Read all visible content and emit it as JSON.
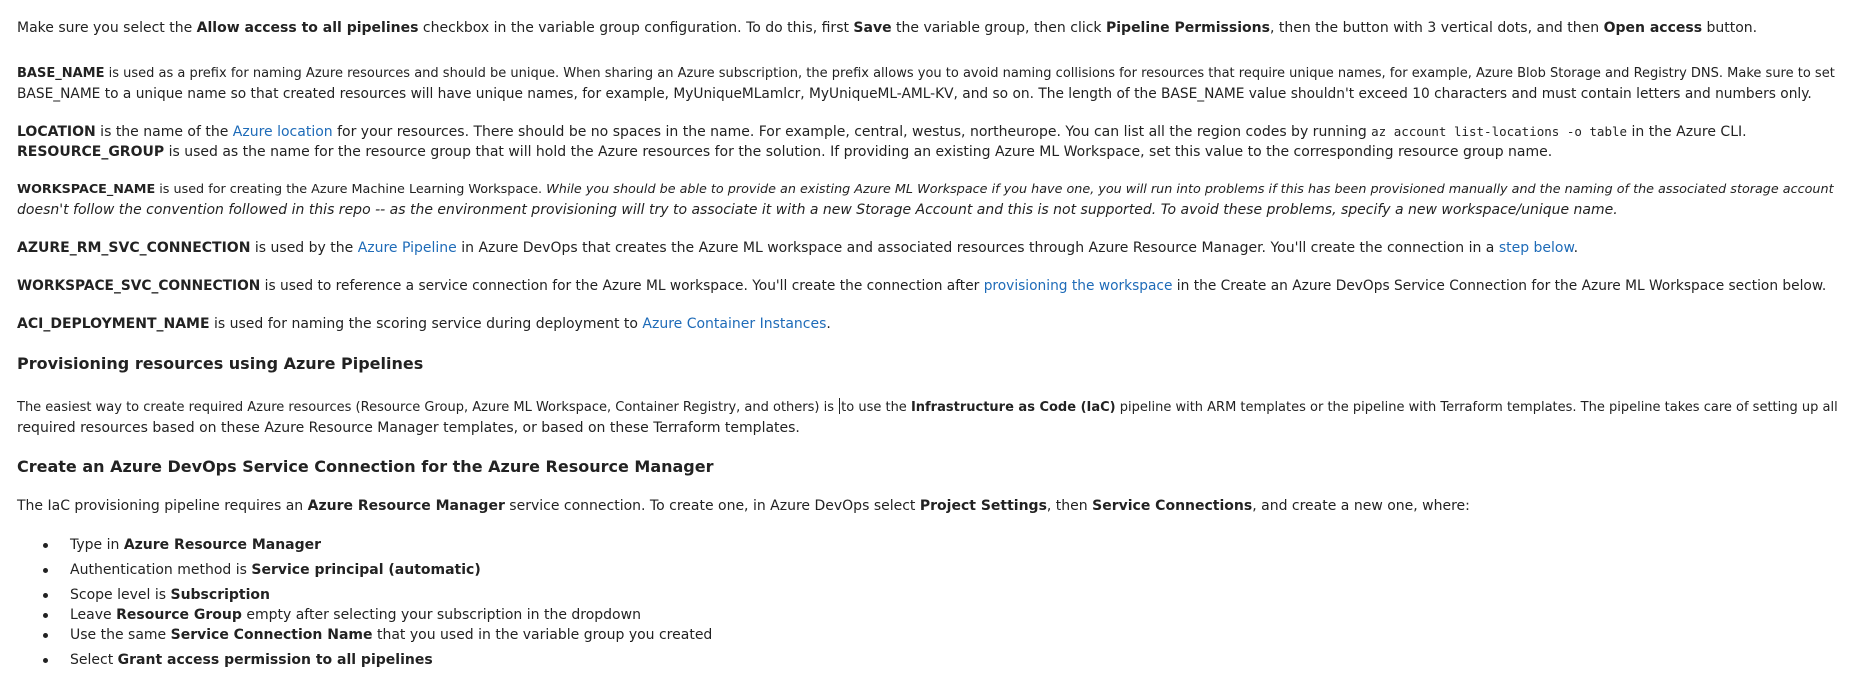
{
  "intro": {
    "t1": "Make sure you select the ",
    "b1": "Allow access to all pipelines",
    "t2": " checkbox in the variable group configuration. To do this, first ",
    "b2": "Save",
    "t3": " the variable group, then click ",
    "b3": "Pipeline Permissions",
    "t4": ", then the button with 3 vertical dots, and then ",
    "b4": "Open access",
    "t5": " button."
  },
  "base_name": {
    "term": "BASE_NAME",
    "l1": " is used as a prefix for naming Azure resources and should be unique. When sharing an Azure subscription, the prefix allows you to avoid naming collisions for resources that require unique names, for example, Azure Blob Storage and Registry DNS. Make sure to set",
    "l2": "BASE_NAME to a unique name so that created resources will have unique names, for example, MyUniqueMLamlcr, MyUniqueML-AML-KV, and so on. The length of the BASE_NAME value shouldn't exceed 10 characters and must contain letters and numbers only."
  },
  "location": {
    "term": "LOCATION",
    "t1": " is the name of the ",
    "link": "Azure location",
    "t2": " for your resources. There should be no spaces in the name. For example, central, westus, northeurope. You can list all the region codes by running ",
    "code": "az account list-locations -o table",
    "t3": " in the Azure CLI."
  },
  "resource_group": {
    "term": "RESOURCE_GROUP",
    "t1": " is used as the name for the resource group that will hold the Azure resources for the solution. If providing an existing Azure ML Workspace, set this value to the corresponding resource group name."
  },
  "workspace_name": {
    "term": "WORKSPACE_NAME",
    "t1": " is used for creating the Azure Machine Learning Workspace. ",
    "i1": "While you should be able to provide an existing Azure ML Workspace if you have one, you will run into problems if this has been provisioned manually and the naming of the associated storage account",
    "i2": "doesn't follow the convention followed in this repo -- as the environment provisioning will try to associate it with a new Storage Account and this is not supported. To avoid these problems, specify a new workspace/unique name."
  },
  "rm_conn": {
    "term": "AZURE_RM_SVC_CONNECTION",
    "t1": " is used by the ",
    "link1": "Azure Pipeline",
    "t2": " in Azure DevOps that creates the Azure ML workspace and associated resources through Azure Resource Manager. You'll create the connection in a ",
    "link2": "step below",
    "t3": "."
  },
  "ws_conn": {
    "term": "WORKSPACE_SVC_CONNECTION",
    "t1": " is used to reference a service connection for the Azure ML workspace. You'll create the connection after ",
    "link": "provisioning the workspace",
    "t2": " in the Create an Azure DevOps Service Connection for the Azure ML Workspace section below."
  },
  "aci": {
    "term": "ACI_DEPLOYMENT_NAME",
    "t1": " is used for naming the scoring service during deployment to ",
    "link": "Azure Container Instances",
    "t2": "."
  },
  "section1": {
    "heading": "Provisioning resources using Azure Pipelines",
    "t1": "The easiest way to create required Azure resources (Resource Group, Azure ML Workspace, Container Registry, and others) is ",
    "t2": "to use the ",
    "b1": "Infrastructure as Code (IaC)",
    "t3": " pipeline with ARM templates or the pipeline with Terraform templates. The pipeline takes care of setting up all",
    "l2": "required resources based on these Azure Resource Manager templates, or based on these Terraform templates."
  },
  "section2": {
    "heading": "Create an Azure DevOps Service Connection for the Azure Resource Manager",
    "t1": "The IaC provisioning pipeline requires an ",
    "b1": "Azure Resource Manager",
    "t2": " service connection. To create one, in Azure DevOps select ",
    "b2": "Project Settings",
    "t3": ", then ",
    "b3": "Service Connections",
    "t4": ", and create a new one, where:"
  },
  "bullets": [
    {
      "pre": "Type in ",
      "bold": "Azure Resource Manager",
      "post": ""
    },
    {
      "pre": "Authentication method is ",
      "bold": "Service principal (automatic)",
      "post": ""
    },
    {
      "pre": "Scope level is ",
      "bold": "Subscription",
      "post": ""
    },
    {
      "pre": "Leave ",
      "bold": "Resource Group",
      "post": " empty after selecting your subscription in the dropdown"
    },
    {
      "pre": "Use the same ",
      "bold": "Service Connection Name",
      "post": " that you used in the variable group you created"
    },
    {
      "pre": "Select ",
      "bold": "Grant access permission to all pipelines",
      "post": ""
    }
  ]
}
